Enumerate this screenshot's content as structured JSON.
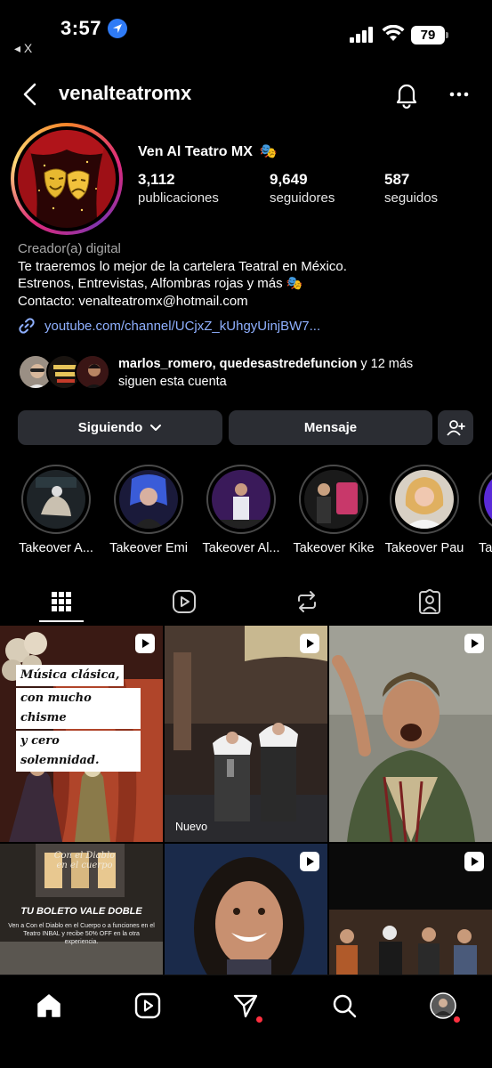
{
  "status_bar": {
    "time": "3:57",
    "back_app": "◂ X",
    "battery": "79"
  },
  "header": {
    "username": "venalteatromx"
  },
  "profile": {
    "display_name": "Ven Al Teatro MX",
    "display_emoji": "🎭",
    "stats": [
      {
        "value": "3,112",
        "label": "publicaciones"
      },
      {
        "value": "9,649",
        "label": "seguidores"
      },
      {
        "value": "587",
        "label": "seguidos"
      }
    ],
    "category": "Creador(a) digital",
    "bio_line1": "Te traeremos lo mejor de la cartelera Teatral en México.",
    "bio_line2": "Estrenos, Entrevistas, Alfombras rojas y más 🎭",
    "bio_line3": "Contacto: venalteatromx@hotmail.com",
    "link": "youtube.com/channel/UCjxZ_kUhgyUinjBW7..."
  },
  "followed_by": {
    "names": "marlos_romero, quedesastredefuncion",
    "suffix": " y 12 más",
    "line2": "siguen esta cuenta"
  },
  "buttons": {
    "following": "Siguiendo",
    "message": "Mensaje"
  },
  "highlights": [
    {
      "label": "Takeover A..."
    },
    {
      "label": "Takeover Emi"
    },
    {
      "label": "Takeover Al..."
    },
    {
      "label": "Takeover Kike"
    },
    {
      "label": "Takeover Pau"
    },
    {
      "label": "Tak"
    }
  ],
  "posts": {
    "post1_lines": [
      "Música clásica,",
      "con mucho chisme",
      "y cero solemnidad."
    ],
    "post2_tag": "Nuevo",
    "post4_script": "Con el Diablo en el cuerpo",
    "post4_title": "TU BOLETO VALE DOBLE",
    "post4_desc": "Ven a Con el Diablo en el Cuerpo o a funciones en el Teatro INBAL y recibe 50% OFF en la otra experiencia."
  },
  "colors": {
    "background": "#000000",
    "button_bg": "#2b2d33",
    "link": "#8fb0ff",
    "notification_dot": "#ff3040"
  }
}
